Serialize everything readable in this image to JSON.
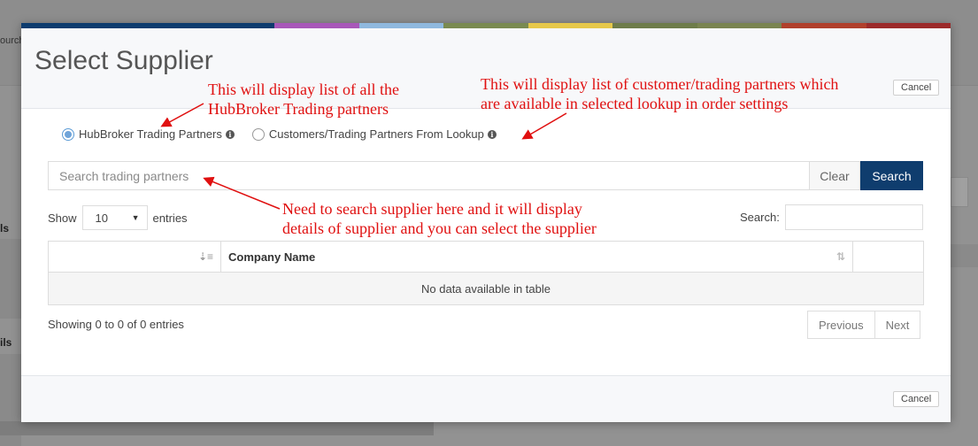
{
  "background": {
    "search_stub": "ourch",
    "label_1": "ls",
    "label_2": "ils"
  },
  "modal": {
    "title": "Select Supplier",
    "strip_colors": [
      "#0d3c6e",
      "#0d3c6e",
      "#0d3c6e",
      "#a858b8",
      "#8fb8de",
      "#7a8a50",
      "#e6c84a",
      "#6e7c4a",
      "#7a8450",
      "#b0402c",
      "#9c2a2a"
    ],
    "header_cancel_label": "Cancel",
    "footer_cancel_label": "Cancel",
    "radio_options": [
      {
        "label": "HubBroker Trading Partners",
        "checked": true
      },
      {
        "label": "Customers/Trading Partners From Lookup",
        "checked": false
      }
    ],
    "search": {
      "placeholder": "Search trading partners",
      "clear_label": "Clear",
      "search_label": "Search"
    },
    "length": {
      "show_label": "Show",
      "selected": "10",
      "entries_label": "entries"
    },
    "filter_label": "Search:",
    "table": {
      "columns": [
        "",
        "Company Name",
        ""
      ],
      "empty_message": "No data available in table"
    },
    "info": "Showing 0 to 0 of 0 entries",
    "pagination": {
      "previous": "Previous",
      "next": "Next"
    }
  },
  "annotations": {
    "a1": "This will display list of all the\nHubBroker Trading partners",
    "a2": "This will display list of customer/trading partners which\nare available in selected lookup in order settings",
    "a3": "Need to search supplier here and it will display\ndetails of supplier and you can select the supplier",
    "color": "#e01010"
  }
}
